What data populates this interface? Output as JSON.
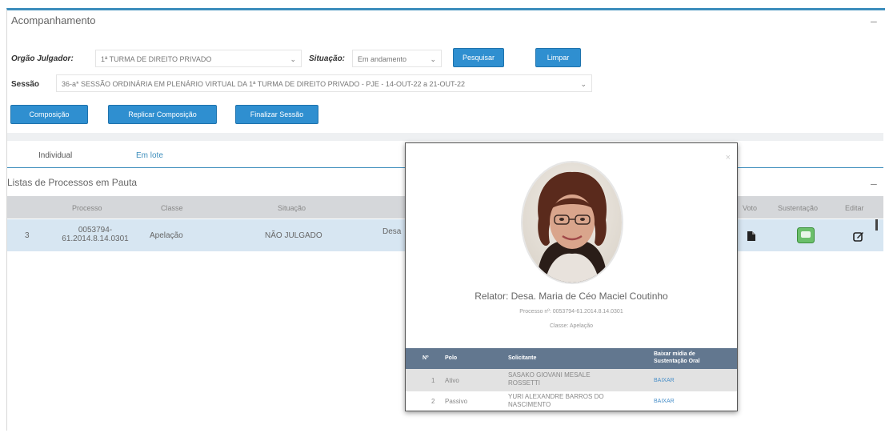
{
  "panel": {
    "title": "Acompanhamento",
    "collapse": "–"
  },
  "filters": {
    "orgao_label": "Orgão Julgador:",
    "orgao_value": "1ª TURMA DE DIREITO PRIVADO",
    "situacao_label": "Situação:",
    "situacao_value": "Em andamento",
    "sessao_label": "Sessão",
    "sessao_value": "36-a* SESSÃO ORDINÁRIA EM PLENÁRIO VIRTUAL DA 1ª TURMA DE DIREITO PRIVADO - PJE - 14-OUT-22 a 21-OUT-22",
    "caret": "⌄"
  },
  "buttons": {
    "pesquisar": "Pesquisar",
    "limpar": "Limpar",
    "composicao": "Composição",
    "replicar": "Replicar Composição",
    "finalizar": "Finalizar Sessão"
  },
  "tabs": [
    {
      "label": "Individual"
    },
    {
      "label": "Em lote"
    }
  ],
  "list": {
    "title": "Listas de Processos em Pauta",
    "collapse": "–",
    "columns": {
      "processo": "Processo",
      "classe": "Classe",
      "situacao": "Situação",
      "voto": "Voto",
      "sustentacao": "Sustentação",
      "editar": "Editar"
    },
    "rows": [
      {
        "index": "3",
        "processo_line1": "0053794-",
        "processo_line2": "61.2014.8.14.0301",
        "classe": "Apelação",
        "situacao": "NÃO JULGADO",
        "relator": "Desa"
      }
    ]
  },
  "modal": {
    "close": "×",
    "relator": "Relator: Desa. Maria de Céo Maciel Coutinho",
    "processo": "Processo nº: 0053794-61.2014.8.14.0301",
    "classe": "Classe: Apelação",
    "columns": {
      "numero": "Nº",
      "polo": "Polo",
      "solicitante": "Solicitante",
      "arquivo": "Baixar mídia de Sustentação Oral"
    },
    "rows": [
      {
        "numero": "1",
        "polo": "Ativo",
        "solicitante_line1": "SASAKO GIOVANI MESALE",
        "solicitante_line2": "ROSSETTI",
        "link": "BAIXAR"
      },
      {
        "numero": "2",
        "polo": "Passivo",
        "solicitante_line1": "YURI ALEXANDRE BARROS DO",
        "solicitante_line2": "NASCIMENTO",
        "link": "BAIXAR"
      }
    ]
  },
  "colors": {
    "accent": "#2f8fd0",
    "header_line": "#3c8dbc",
    "selected_row": "#d7e6f2",
    "modal_header": "#62778f"
  }
}
